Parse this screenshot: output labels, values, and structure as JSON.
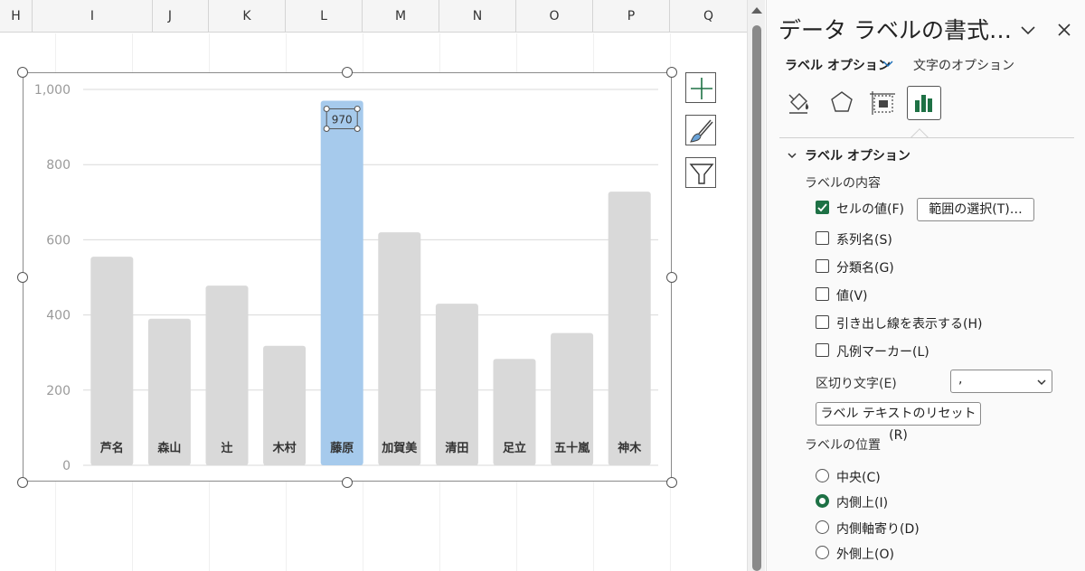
{
  "sheet": {
    "columns": [
      "H",
      "I",
      "J",
      "K",
      "L",
      "M",
      "N",
      "O",
      "P",
      "Q"
    ]
  },
  "chart_data": {
    "type": "bar",
    "categories": [
      "芦名",
      "森山",
      "辻",
      "木村",
      "藤原",
      "加賀美",
      "清田",
      "足立",
      "五十嵐",
      "神木"
    ],
    "values": [
      555,
      390,
      478,
      318,
      970,
      620,
      430,
      283,
      352,
      728
    ],
    "yticks": [
      "0",
      "200",
      "400",
      "600",
      "800",
      "1,000"
    ],
    "ylim": [
      0,
      1000
    ],
    "grid": true,
    "highlighted_index": 4,
    "data_label": "970",
    "colors": {
      "bar": "#d9d9d9",
      "highlight": "#a6caec"
    }
  },
  "chart_tools": {
    "add_element": "plus-icon",
    "style": "brush-icon",
    "filter": "filter-icon"
  },
  "pane": {
    "title": "データ ラベルの書式…",
    "tab_label_options": "ラベル オプション",
    "tab_text_options": "文字のオプション",
    "section_label_options": "ラベル オプション",
    "label_contains": "ラベルの内容",
    "cell_value": "セルの値(F)",
    "select_range": "範囲の選択(T)…",
    "series_name": "系列名(S)",
    "category_name": "分類名(G)",
    "value": "値(V)",
    "leader_lines": "引き出し線を表示する(H)",
    "legend_key": "凡例マーカー(L)",
    "separator_label": "区切り文字(E)",
    "separator_value": ",",
    "reset_label_text": "ラベル テキストのリセット(R)",
    "label_position": "ラベルの位置",
    "pos_center": "中央(C)",
    "pos_inside_end": "内側上(I)",
    "pos_inside_base": "内側軸寄り(D)",
    "pos_outside_end": "外側上(O)",
    "accent": "#1e7145"
  }
}
